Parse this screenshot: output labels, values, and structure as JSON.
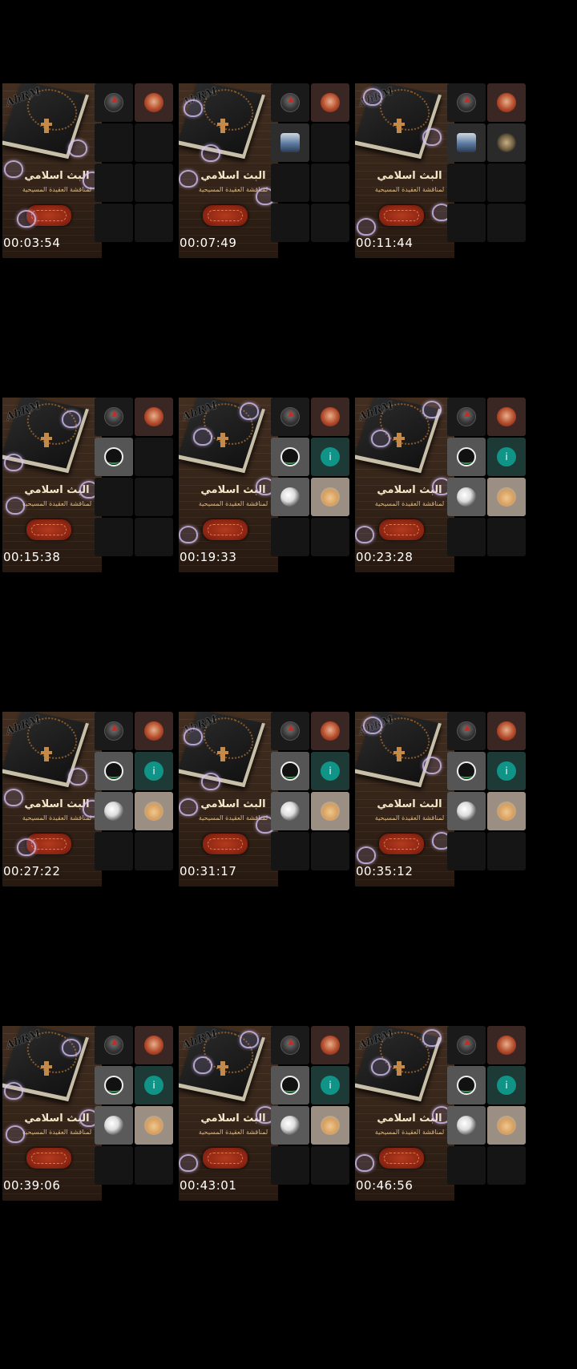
{
  "cover": {
    "logo_text": "AhRM",
    "title_ar": "البث اسلامي",
    "subtitle_ar": "لمناقشة العقيدة المسيحية"
  },
  "frames": [
    {
      "timestamp": "00:03:54",
      "tiles": [
        "host",
        "man",
        "empty",
        "empty",
        "empty",
        "empty",
        "empty",
        "empty"
      ]
    },
    {
      "timestamp": "00:07:49",
      "tiles": [
        "host",
        "man",
        "guest1",
        "empty",
        "empty",
        "empty",
        "empty",
        "empty"
      ]
    },
    {
      "timestamp": "00:11:44",
      "tiles": [
        "host",
        "man",
        "guest1",
        "guest2",
        "empty",
        "empty",
        "empty",
        "empty"
      ]
    },
    {
      "timestamp": "00:15:38",
      "tiles": [
        "host",
        "man",
        "dark",
        "empty",
        "empty",
        "empty",
        "empty",
        "empty"
      ]
    },
    {
      "timestamp": "00:19:33",
      "tiles": [
        "host",
        "man",
        "dark",
        "info",
        "moon",
        "bunny",
        "empty",
        "empty"
      ]
    },
    {
      "timestamp": "00:23:28",
      "tiles": [
        "host",
        "man",
        "dark",
        "info",
        "moon",
        "bunny",
        "empty",
        "empty"
      ]
    },
    {
      "timestamp": "00:27:22",
      "tiles": [
        "host",
        "man",
        "dark",
        "info",
        "moon",
        "bunny",
        "empty",
        "empty"
      ]
    },
    {
      "timestamp": "00:31:17",
      "tiles": [
        "host",
        "man",
        "dark",
        "info",
        "moon",
        "bunny",
        "empty",
        "empty"
      ]
    },
    {
      "timestamp": "00:35:12",
      "tiles": [
        "host",
        "man",
        "dark",
        "info",
        "moon",
        "bunny",
        "empty",
        "empty"
      ]
    },
    {
      "timestamp": "00:39:06",
      "tiles": [
        "host",
        "man",
        "dark",
        "info",
        "moon",
        "bunny",
        "empty",
        "empty"
      ]
    },
    {
      "timestamp": "00:43:01",
      "tiles": [
        "host",
        "man",
        "dark",
        "info",
        "moon",
        "bunny",
        "empty",
        "empty"
      ]
    },
    {
      "timestamp": "00:46:56",
      "tiles": [
        "host",
        "man",
        "dark",
        "info",
        "moon",
        "bunny",
        "empty",
        "empty"
      ]
    }
  ],
  "tile_icons": {
    "host": "host-logo-avatar",
    "man": "man-portrait-avatar",
    "guest1": "guest-photo-avatar",
    "guest2": "guest-photo-avatar",
    "dark": "ring-avatar",
    "info": "info-icon",
    "moon": "moon-avatar",
    "bunny": "bunny-avatar",
    "empty": "empty-slot"
  },
  "info_glyph": "i"
}
